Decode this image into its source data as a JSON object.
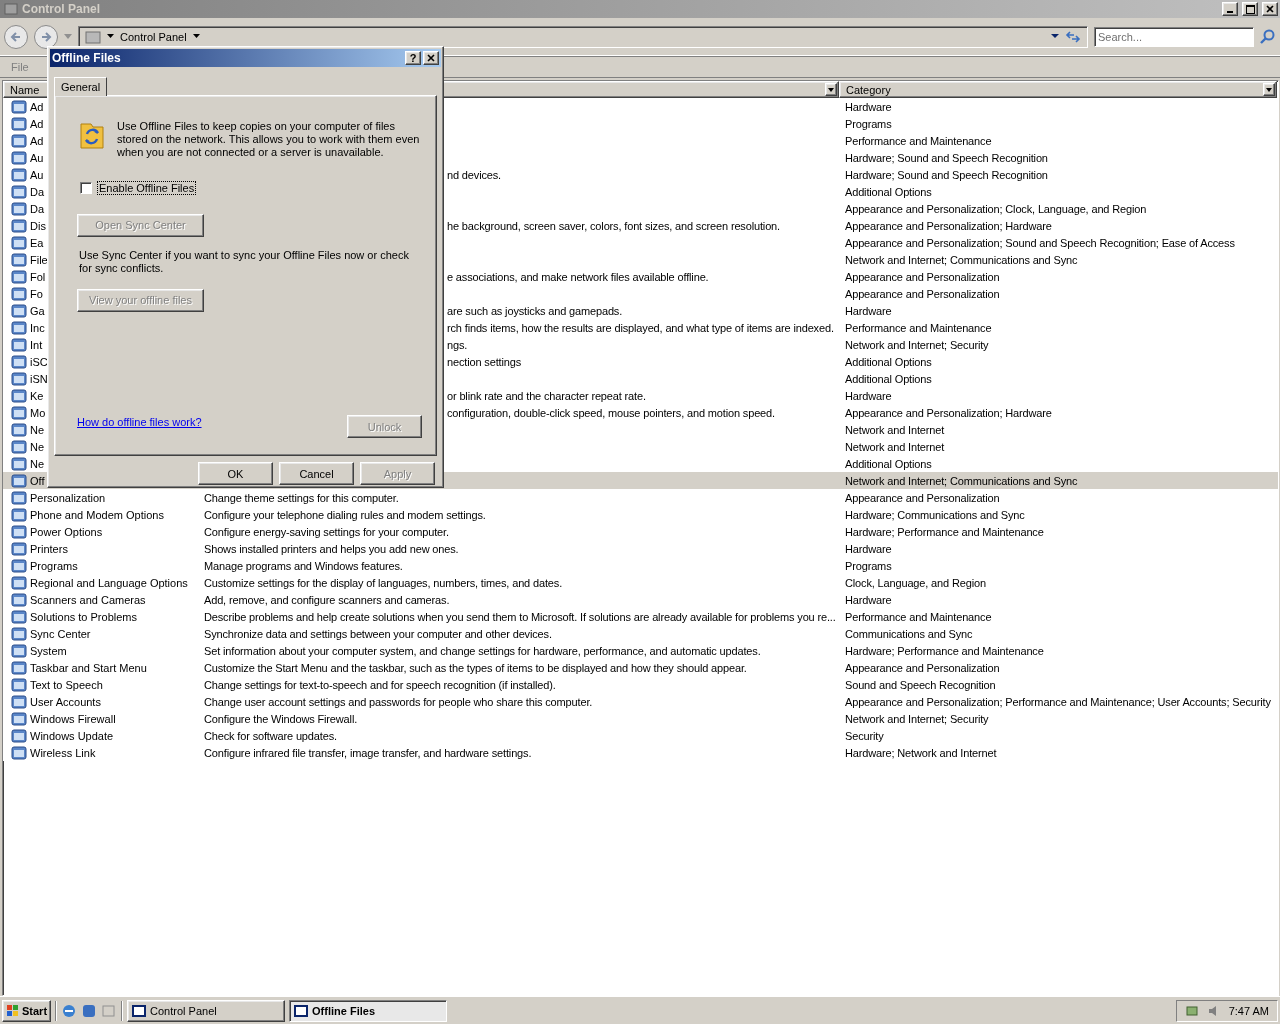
{
  "window": {
    "title": "Control Panel"
  },
  "address_bar": {
    "path": "Control Panel",
    "search": {
      "placeholder": "Search..."
    }
  },
  "menu": [
    "File"
  ],
  "list": {
    "columns": {
      "name": "Name",
      "category": "Category"
    },
    "rows": [
      {
        "kind": "covered",
        "name": "Ad",
        "category": "Hardware",
        "selected": false
      },
      {
        "kind": "covered",
        "name": "Ad",
        "category": "Programs",
        "selected": false
      },
      {
        "kind": "covered",
        "name": "Ad",
        "category": "Performance and Maintenance",
        "selected": false
      },
      {
        "kind": "covered",
        "name": "Au",
        "category": "Hardware; Sound and Speech Recognition",
        "selected": false
      },
      {
        "kind": "covered",
        "name": "Au",
        "description": "nd devices.",
        "category": "Hardware; Sound and Speech Recognition",
        "selected": false
      },
      {
        "kind": "covered",
        "name": "Da",
        "category": "Additional Options",
        "selected": false
      },
      {
        "kind": "covered",
        "name": "Da",
        "category": "Appearance and Personalization; Clock, Language, and Region",
        "selected": false
      },
      {
        "kind": "covered",
        "name": "Dis",
        "description": "he background, screen saver, colors, font sizes, and screen resolution.",
        "category": "Appearance and Personalization; Hardware",
        "selected": false
      },
      {
        "kind": "covered",
        "name": "Ea",
        "category": "Appearance and Personalization; Sound and Speech Recognition; Ease of Access",
        "selected": false
      },
      {
        "kind": "covered",
        "name": "File",
        "category": "Network and Internet; Communications and Sync",
        "selected": false
      },
      {
        "kind": "covered",
        "name": "Fol",
        "description": "e associations, and make network files available offline.",
        "category": "Appearance and Personalization",
        "selected": false
      },
      {
        "kind": "covered",
        "name": "Fo",
        "category": "Appearance and Personalization",
        "selected": false
      },
      {
        "kind": "covered",
        "name": "Ga",
        "description": "are such as joysticks and gamepads.",
        "category": "Hardware",
        "selected": false
      },
      {
        "kind": "covered",
        "name": "Inc",
        "description": "rch finds items, how the results are displayed, and what type of items are indexed.",
        "category": "Performance and Maintenance",
        "selected": false
      },
      {
        "kind": "covered",
        "name": "Int",
        "description": "ngs.",
        "category": "Network and Internet; Security",
        "selected": false
      },
      {
        "kind": "covered",
        "name": "iSC",
        "description": "nection settings",
        "category": "Additional Options",
        "selected": false
      },
      {
        "kind": "covered",
        "name": "iSN",
        "category": "Additional Options",
        "selected": false
      },
      {
        "kind": "covered",
        "name": "Ke",
        "description": "or blink rate and the character repeat rate.",
        "category": "Hardware",
        "selected": false
      },
      {
        "kind": "covered",
        "name": "Mo",
        "description": "configuration, double-click speed, mouse pointers, and motion speed.",
        "category": "Appearance and Personalization; Hardware",
        "selected": false
      },
      {
        "kind": "covered",
        "name": "Ne",
        "category": "Network and Internet",
        "selected": false
      },
      {
        "kind": "covered",
        "name": "Ne",
        "category": "Network and Internet",
        "selected": false
      },
      {
        "kind": "covered",
        "name": "Ne",
        "category": "Additional Options",
        "selected": false
      },
      {
        "kind": "covered",
        "name": "Off",
        "category": "Network and Internet; Communications and Sync",
        "selected": true
      },
      {
        "kind": "full",
        "name": "Personalization",
        "description": "Change theme settings for this computer.",
        "category": "Appearance and Personalization",
        "selected": false
      },
      {
        "kind": "full",
        "name": "Phone and Modem Options",
        "description": "Configure your telephone dialing rules and modem settings.",
        "category": "Hardware; Communications and Sync",
        "selected": false
      },
      {
        "kind": "full",
        "name": "Power Options",
        "description": "Configure energy-saving settings for your computer.",
        "category": "Hardware; Performance and Maintenance",
        "selected": false
      },
      {
        "kind": "full",
        "name": "Printers",
        "description": "Shows installed printers and helps you add new ones.",
        "category": "Hardware",
        "selected": false
      },
      {
        "kind": "full",
        "name": "Programs",
        "description": "Manage programs and Windows features.",
        "category": "Programs",
        "selected": false
      },
      {
        "kind": "full",
        "name": "Regional and Language Options",
        "description": "Customize settings for the display of languages, numbers, times, and dates.",
        "category": "Clock, Language, and Region",
        "selected": false
      },
      {
        "kind": "full",
        "name": "Scanners and Cameras",
        "description": "Add, remove, and configure scanners and cameras.",
        "category": "Hardware",
        "selected": false
      },
      {
        "kind": "full",
        "name": "Solutions to Problems",
        "description": "Describe problems and help create solutions when you send them to Microsoft. If solutions are already available for problems you re...",
        "category": "Performance and Maintenance",
        "selected": false
      },
      {
        "kind": "full",
        "name": "Sync Center",
        "description": "Synchronize data and settings between your computer and other devices.",
        "category": "Communications and Sync",
        "selected": false
      },
      {
        "kind": "full",
        "name": "System",
        "description": "Set information about your computer system, and change settings for hardware, performance, and automatic updates.",
        "category": "Hardware; Performance and Maintenance",
        "selected": false
      },
      {
        "kind": "full",
        "name": "Taskbar and Start Menu",
        "description": "Customize the Start Menu and the taskbar, such as the types of items to be displayed and how they should appear.",
        "category": "Appearance and Personalization",
        "selected": false
      },
      {
        "kind": "full",
        "name": "Text to Speech",
        "description": "Change settings for text-to-speech and for speech recognition (if installed).",
        "category": "Sound and Speech Recognition",
        "selected": false
      },
      {
        "kind": "full",
        "name": "User Accounts",
        "description": "Change user account settings and passwords for people who share this computer.",
        "category": "Appearance and Personalization; Performance and Maintenance; User Accounts; Security",
        "selected": false
      },
      {
        "kind": "full",
        "name": "Windows Firewall",
        "description": "Configure the Windows Firewall.",
        "category": "Network and Internet; Security",
        "selected": false
      },
      {
        "kind": "full",
        "name": "Windows Update",
        "description": "Check for software updates.",
        "category": "Security",
        "selected": false
      },
      {
        "kind": "full",
        "name": "Wireless Link",
        "description": "Configure infrared file transfer, image transfer, and hardware settings.",
        "category": "Hardware; Network and Internet",
        "selected": false
      }
    ]
  },
  "dialog": {
    "title": "Offline Files",
    "help": "?",
    "tabs": [
      {
        "label": "General",
        "selected": true
      }
    ],
    "intro": "Use Offline Files to keep copies on your computer of files stored on the network.  This allows you to work with them even when you are not connected or a server is unavailable.",
    "checkbox": {
      "label": "Enable Offline Files",
      "checked": false
    },
    "sync_button": {
      "label": "Open Sync Center",
      "disabled": true
    },
    "sync_text": "Use Sync Center if you want to sync your Offline Files now or check for sync conflicts.",
    "view_button": {
      "label": "View your offline files",
      "disabled": true
    },
    "link": "How do offline files work?",
    "unlock_button": {
      "label": "Unlock",
      "disabled": true
    },
    "footer_buttons": [
      {
        "label": "OK",
        "disabled": false
      },
      {
        "label": "Cancel",
        "disabled": false
      },
      {
        "label": "Apply",
        "disabled": true
      }
    ]
  },
  "taskbar": {
    "start": "Start",
    "tasks": [
      {
        "label": "Control Panel",
        "selected": false
      },
      {
        "label": "Offline Files",
        "selected": true
      }
    ],
    "clock": "7:47 AM"
  }
}
